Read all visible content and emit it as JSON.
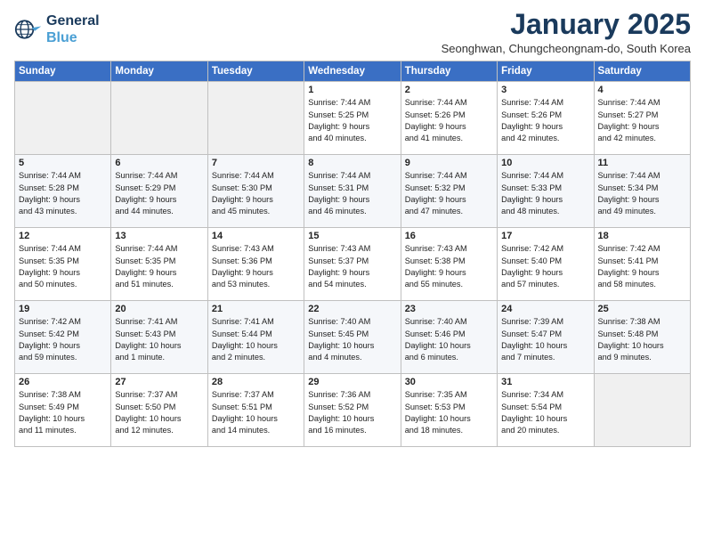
{
  "header": {
    "logo_line1": "General",
    "logo_line2": "Blue",
    "title": "January 2025",
    "subtitle": "Seonghwan, Chungcheongnam-do, South Korea"
  },
  "days_of_week": [
    "Sunday",
    "Monday",
    "Tuesday",
    "Wednesday",
    "Thursday",
    "Friday",
    "Saturday"
  ],
  "weeks": [
    [
      {
        "day": "",
        "info": ""
      },
      {
        "day": "",
        "info": ""
      },
      {
        "day": "",
        "info": ""
      },
      {
        "day": "1",
        "info": "Sunrise: 7:44 AM\nSunset: 5:25 PM\nDaylight: 9 hours\nand 40 minutes."
      },
      {
        "day": "2",
        "info": "Sunrise: 7:44 AM\nSunset: 5:26 PM\nDaylight: 9 hours\nand 41 minutes."
      },
      {
        "day": "3",
        "info": "Sunrise: 7:44 AM\nSunset: 5:26 PM\nDaylight: 9 hours\nand 42 minutes."
      },
      {
        "day": "4",
        "info": "Sunrise: 7:44 AM\nSunset: 5:27 PM\nDaylight: 9 hours\nand 42 minutes."
      }
    ],
    [
      {
        "day": "5",
        "info": "Sunrise: 7:44 AM\nSunset: 5:28 PM\nDaylight: 9 hours\nand 43 minutes."
      },
      {
        "day": "6",
        "info": "Sunrise: 7:44 AM\nSunset: 5:29 PM\nDaylight: 9 hours\nand 44 minutes."
      },
      {
        "day": "7",
        "info": "Sunrise: 7:44 AM\nSunset: 5:30 PM\nDaylight: 9 hours\nand 45 minutes."
      },
      {
        "day": "8",
        "info": "Sunrise: 7:44 AM\nSunset: 5:31 PM\nDaylight: 9 hours\nand 46 minutes."
      },
      {
        "day": "9",
        "info": "Sunrise: 7:44 AM\nSunset: 5:32 PM\nDaylight: 9 hours\nand 47 minutes."
      },
      {
        "day": "10",
        "info": "Sunrise: 7:44 AM\nSunset: 5:33 PM\nDaylight: 9 hours\nand 48 minutes."
      },
      {
        "day": "11",
        "info": "Sunrise: 7:44 AM\nSunset: 5:34 PM\nDaylight: 9 hours\nand 49 minutes."
      }
    ],
    [
      {
        "day": "12",
        "info": "Sunrise: 7:44 AM\nSunset: 5:35 PM\nDaylight: 9 hours\nand 50 minutes."
      },
      {
        "day": "13",
        "info": "Sunrise: 7:44 AM\nSunset: 5:35 PM\nDaylight: 9 hours\nand 51 minutes."
      },
      {
        "day": "14",
        "info": "Sunrise: 7:43 AM\nSunset: 5:36 PM\nDaylight: 9 hours\nand 53 minutes."
      },
      {
        "day": "15",
        "info": "Sunrise: 7:43 AM\nSunset: 5:37 PM\nDaylight: 9 hours\nand 54 minutes."
      },
      {
        "day": "16",
        "info": "Sunrise: 7:43 AM\nSunset: 5:38 PM\nDaylight: 9 hours\nand 55 minutes."
      },
      {
        "day": "17",
        "info": "Sunrise: 7:42 AM\nSunset: 5:40 PM\nDaylight: 9 hours\nand 57 minutes."
      },
      {
        "day": "18",
        "info": "Sunrise: 7:42 AM\nSunset: 5:41 PM\nDaylight: 9 hours\nand 58 minutes."
      }
    ],
    [
      {
        "day": "19",
        "info": "Sunrise: 7:42 AM\nSunset: 5:42 PM\nDaylight: 9 hours\nand 59 minutes."
      },
      {
        "day": "20",
        "info": "Sunrise: 7:41 AM\nSunset: 5:43 PM\nDaylight: 10 hours\nand 1 minute."
      },
      {
        "day": "21",
        "info": "Sunrise: 7:41 AM\nSunset: 5:44 PM\nDaylight: 10 hours\nand 2 minutes."
      },
      {
        "day": "22",
        "info": "Sunrise: 7:40 AM\nSunset: 5:45 PM\nDaylight: 10 hours\nand 4 minutes."
      },
      {
        "day": "23",
        "info": "Sunrise: 7:40 AM\nSunset: 5:46 PM\nDaylight: 10 hours\nand 6 minutes."
      },
      {
        "day": "24",
        "info": "Sunrise: 7:39 AM\nSunset: 5:47 PM\nDaylight: 10 hours\nand 7 minutes."
      },
      {
        "day": "25",
        "info": "Sunrise: 7:38 AM\nSunset: 5:48 PM\nDaylight: 10 hours\nand 9 minutes."
      }
    ],
    [
      {
        "day": "26",
        "info": "Sunrise: 7:38 AM\nSunset: 5:49 PM\nDaylight: 10 hours\nand 11 minutes."
      },
      {
        "day": "27",
        "info": "Sunrise: 7:37 AM\nSunset: 5:50 PM\nDaylight: 10 hours\nand 12 minutes."
      },
      {
        "day": "28",
        "info": "Sunrise: 7:37 AM\nSunset: 5:51 PM\nDaylight: 10 hours\nand 14 minutes."
      },
      {
        "day": "29",
        "info": "Sunrise: 7:36 AM\nSunset: 5:52 PM\nDaylight: 10 hours\nand 16 minutes."
      },
      {
        "day": "30",
        "info": "Sunrise: 7:35 AM\nSunset: 5:53 PM\nDaylight: 10 hours\nand 18 minutes."
      },
      {
        "day": "31",
        "info": "Sunrise: 7:34 AM\nSunset: 5:54 PM\nDaylight: 10 hours\nand 20 minutes."
      },
      {
        "day": "",
        "info": ""
      }
    ]
  ]
}
